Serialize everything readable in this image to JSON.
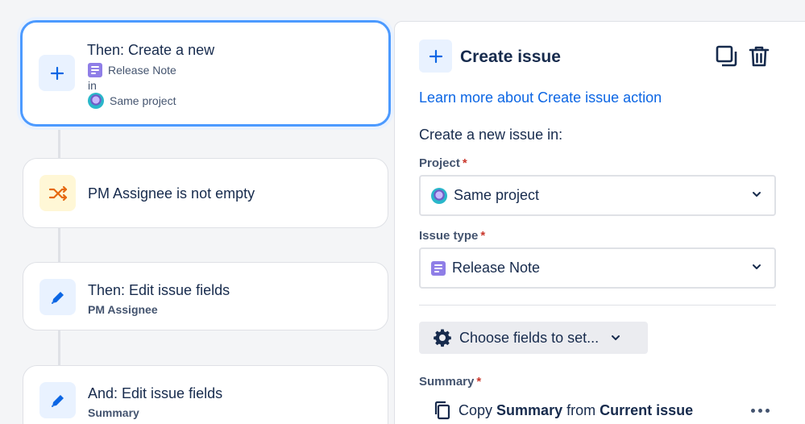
{
  "flow": {
    "create_card": {
      "title": "Then: Create a new",
      "issue_type": "Release Note",
      "in_label": "in",
      "project": "Same project"
    },
    "condition_card": {
      "title": "PM Assignee is not empty"
    },
    "edit_card_1": {
      "title": "Then: Edit issue fields",
      "subtitle": "PM Assignee"
    },
    "edit_card_2": {
      "title": "And: Edit issue fields",
      "subtitle": "Summary"
    }
  },
  "panel": {
    "title": "Create issue",
    "learn_more_link": "Learn more about Create issue action",
    "create_in_text": "Create a new issue in:",
    "project_field": {
      "label": "Project",
      "required_mark": "*",
      "value": "Same project"
    },
    "issue_type_field": {
      "label": "Issue type",
      "required_mark": "*",
      "value": "Release Note"
    },
    "choose_fields_button": "Choose fields to set...",
    "summary_field": {
      "label": "Summary",
      "required_mark": "*",
      "copy_prefix": "Copy",
      "copy_field": "Summary",
      "copy_from": "from",
      "copy_source": "Current issue"
    }
  },
  "icons": {
    "add": "plus-icon",
    "condition": "shuffle-icon",
    "edit": "pencil-icon",
    "duplicate": "duplicate-icon",
    "delete": "trash-icon",
    "settings": "gear-icon",
    "dropdown": "chevron-down-icon",
    "copy": "copy-icon",
    "more": "more-icon",
    "issue_type": "release-note-icon",
    "project": "project-avatar-icon"
  },
  "colors": {
    "accent_blue": "#0c66e4",
    "selected_border": "#4c9aff",
    "icon_tile_blue": "#e9f2ff",
    "icon_tile_yellow": "#fff7d6",
    "condition_orange": "#e56910",
    "release_note_purple": "#8f7ee7",
    "required_red": "#c9372c"
  }
}
